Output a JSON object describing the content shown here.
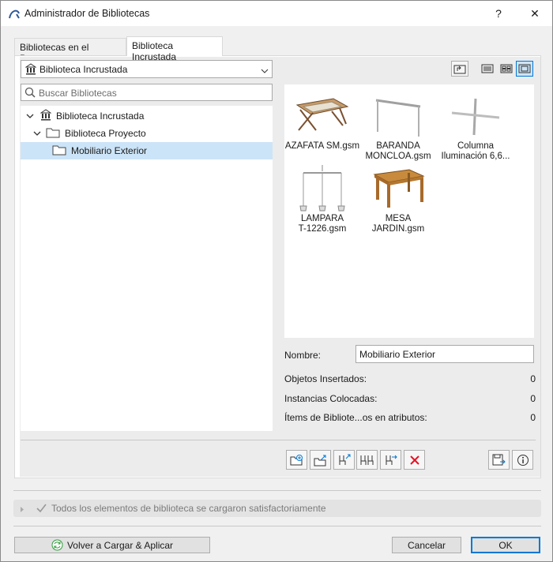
{
  "window": {
    "title": "Administrador de Bibliotecas",
    "help_label": "?",
    "close_label": "✕"
  },
  "tabs": [
    {
      "label": "Bibliotecas en el Proyecto",
      "active": false
    },
    {
      "label": "Biblioteca Incrustada",
      "active": true
    }
  ],
  "library_select": {
    "value": "Biblioteca Incrustada"
  },
  "search": {
    "placeholder": "Buscar Bibliotecas"
  },
  "tree": [
    {
      "label": "Biblioteca Incrustada"
    },
    {
      "label": "Biblioteca Proyecto"
    },
    {
      "label": "Mobiliario Exterior",
      "selected": true
    }
  ],
  "preview_items": [
    {
      "line1": "AZAFATA SM.gsm",
      "line2": ""
    },
    {
      "line1": "BARANDA",
      "line2": "MONCLOA.gsm"
    },
    {
      "line1": "Columna",
      "line2": "Iluminación 6,6..."
    },
    {
      "line1": "LAMPARA",
      "line2": "T-1226.gsm"
    },
    {
      "line1": "MESA",
      "line2": "JARDIN.gsm"
    }
  ],
  "details": {
    "name_label": "Nombre:",
    "name_value": "Mobiliario Exterior",
    "rows": [
      {
        "label": "Objetos Insertados:",
        "value": "0"
      },
      {
        "label": "Instancias Colocadas:",
        "value": "0"
      },
      {
        "label": "Ítems de Bibliote...os en atributos:",
        "value": "0"
      }
    ]
  },
  "status": {
    "text": "Todos los elementos de biblioteca se cargaron satisfactoriamente"
  },
  "buttons": {
    "reload": "Volver a Cargar & Aplicar",
    "cancel": "Cancelar",
    "ok": "OK"
  },
  "colors": {
    "accent": "#0078d7",
    "selection": "#cce4f7",
    "delete": "#e81123"
  }
}
